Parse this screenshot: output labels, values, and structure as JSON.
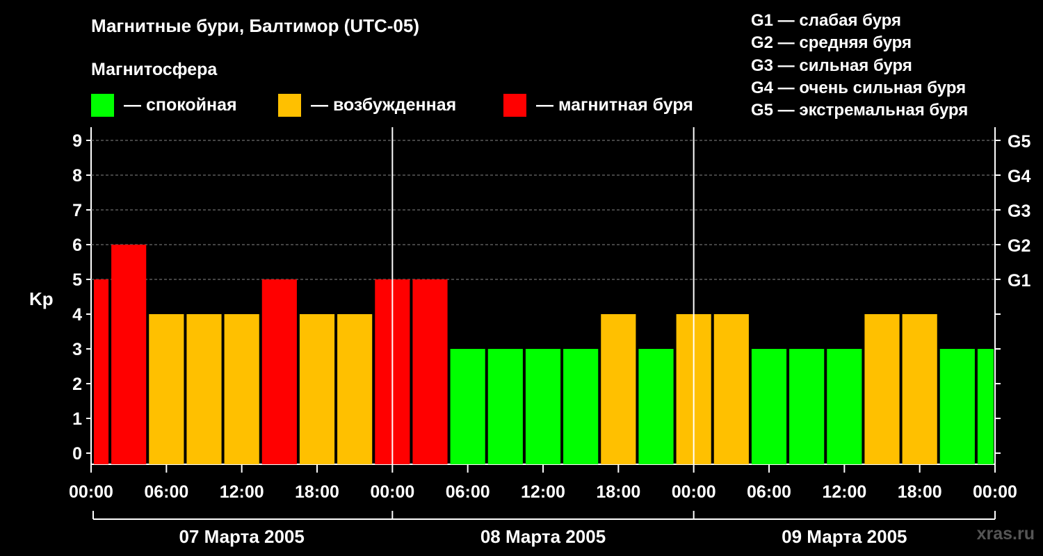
{
  "title": "Магнитные бури, Балтимор (UTC-05)",
  "subtitle": "Магнитосфера",
  "legend": [
    {
      "label": "— спокойная",
      "color": "#00ff00"
    },
    {
      "label": "— возбужденная",
      "color": "#ffc000"
    },
    {
      "label": "— магнитная буря",
      "color": "#ff0000"
    }
  ],
  "g_scale": [
    "G1 — слабая буря",
    "G2 — средняя буря",
    "G3 — сильная буря",
    "G4 — очень сильная буря",
    "G5 — экстремальная буря"
  ],
  "watermark": "xras.ru",
  "chart_data": {
    "type": "bar",
    "ylabel": "Kp",
    "ylim": [
      0,
      9
    ],
    "yticks": [
      "0",
      "1",
      "2",
      "3",
      "4",
      "5",
      "6",
      "7",
      "8",
      "9"
    ],
    "right_axis_labels": [
      {
        "kp": 5,
        "label": "G1"
      },
      {
        "kp": 6,
        "label": "G2"
      },
      {
        "kp": 7,
        "label": "G3"
      },
      {
        "kp": 8,
        "label": "G4"
      },
      {
        "kp": 9,
        "label": "G5"
      }
    ],
    "grid": "horizontal dashed at Kp 5–9",
    "xticks": [
      "00:00",
      "06:00",
      "12:00",
      "18:00",
      "00:00",
      "06:00",
      "12:00",
      "18:00",
      "00:00",
      "06:00",
      "12:00",
      "18:00",
      "00:00"
    ],
    "days": [
      "07 Марта 2005",
      "08 Марта 2005",
      "09 Марта 2005"
    ],
    "colors": {
      "quiet": "#00ff00",
      "unsettled": "#ffc000",
      "storm": "#ff0000"
    },
    "bar_hours": 3,
    "series": [
      {
        "values": [
          5,
          6,
          4,
          4,
          4,
          5,
          4,
          4,
          5,
          5,
          3,
          3,
          3,
          3,
          4,
          3,
          4,
          4,
          3,
          3,
          3,
          4,
          4,
          3,
          3
        ],
        "levels": [
          "storm",
          "storm",
          "unsettled",
          "unsettled",
          "unsettled",
          "storm",
          "unsettled",
          "unsettled",
          "storm",
          "storm",
          "quiet",
          "quiet",
          "quiet",
          "quiet",
          "unsettled",
          "quiet",
          "unsettled",
          "unsettled",
          "quiet",
          "quiet",
          "quiet",
          "unsettled",
          "unsettled",
          "quiet",
          "quiet"
        ]
      }
    ]
  }
}
